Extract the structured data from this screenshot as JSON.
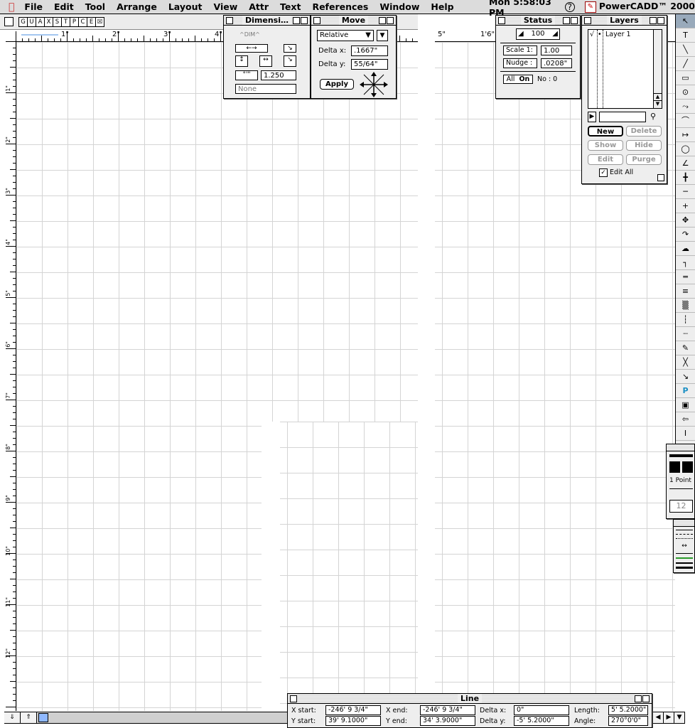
{
  "menubar": {
    "apple": "",
    "items": [
      "File",
      "Edit",
      "Tool",
      "Arrange",
      "Layout",
      "View",
      "Attr",
      "Text",
      "References",
      "Window",
      "Help"
    ],
    "clock": "Mon 5:58:03 PM",
    "app_name": "PowerCADD™ 2000"
  },
  "window": {
    "view_tabs": [
      "G",
      "U",
      "A",
      "X",
      "S",
      "T",
      "P",
      "C",
      "E",
      "☒"
    ],
    "ruler_top_labels": [
      "1\"",
      "2\"",
      "3\"",
      "4\""
    ],
    "ruler_top_right_label": "5\"",
    "ruler_top_right_label2": "1'6\"",
    "ruler_left_labels": [
      "1\"",
      "2\"",
      "3\"",
      "4\"",
      "5\"",
      "6\"",
      "7\"",
      "8\"",
      "9\"",
      "10\"",
      "11\"",
      "12\""
    ]
  },
  "dimensions_palette": {
    "title": "Dimensi…",
    "top_label": "^DIM^",
    "value_field": "1.250",
    "bottom_field": "None"
  },
  "move_palette": {
    "title": "Move",
    "mode": "Relative",
    "delta_x_label": "Delta x:",
    "delta_x": ".1667\"",
    "delta_y_label": "Delta y:",
    "delta_y": "55/64\"",
    "apply": "Apply"
  },
  "status_palette": {
    "title": "Status",
    "zoom": "100",
    "scale_label": "Scale  1:",
    "scale": "1.00",
    "nudge_label": "Nudge   :",
    "nudge": ".0208\"",
    "all_label": "All",
    "on_label": "On",
    "no_label": "No : 0"
  },
  "layers_palette": {
    "title": "Layers",
    "layers": [
      {
        "check": "√",
        "bullet": "•",
        "name": "Layer 1"
      }
    ],
    "new": "New",
    "delete": "Delete",
    "show": "Show",
    "hide": "Hide",
    "edit": "Edit",
    "purge": "Purge",
    "edit_all": "Edit All"
  },
  "pen_palette": {
    "weight": "1 Point",
    "size": "12"
  },
  "line_palette": {
    "title": "Line",
    "x_start_label": "X start:",
    "x_start": "-246' 9 3/4\"",
    "y_start_label": "Y start:",
    "y_start": "39' 9.1000\"",
    "x_end_label": "X end:",
    "x_end": "-246' 9 3/4\"",
    "y_end_label": "Y end:",
    "y_end": "34' 3.9000\"",
    "delta_x_label": "Delta x:",
    "delta_x": "0\"",
    "delta_y_label": "Delta y:",
    "delta_y": "-5' 5.2000\"",
    "length_label": "Length:",
    "length": "5' 5.2000\"",
    "angle_label": "Angle:",
    "angle": "270°0'0\""
  },
  "tools": [
    "↖",
    "T",
    "╲",
    "╱",
    "▭",
    "⊙",
    "⤳",
    "⌒",
    "↦",
    "◯",
    "∠",
    "╋",
    "─",
    "+",
    "✥",
    "↷",
    "☁",
    "┐",
    "═",
    "≡",
    "▒",
    "┆",
    "┈",
    "✎",
    "╳",
    "↘",
    "P",
    "▣",
    "⇦",
    "I",
    "□",
    "┕"
  ],
  "colors": {
    "menubar": "#dcdcdc",
    "palette": "#eeeeee",
    "grid": "#d4d4d4",
    "scroll_thumb": "#8fb8ff"
  }
}
